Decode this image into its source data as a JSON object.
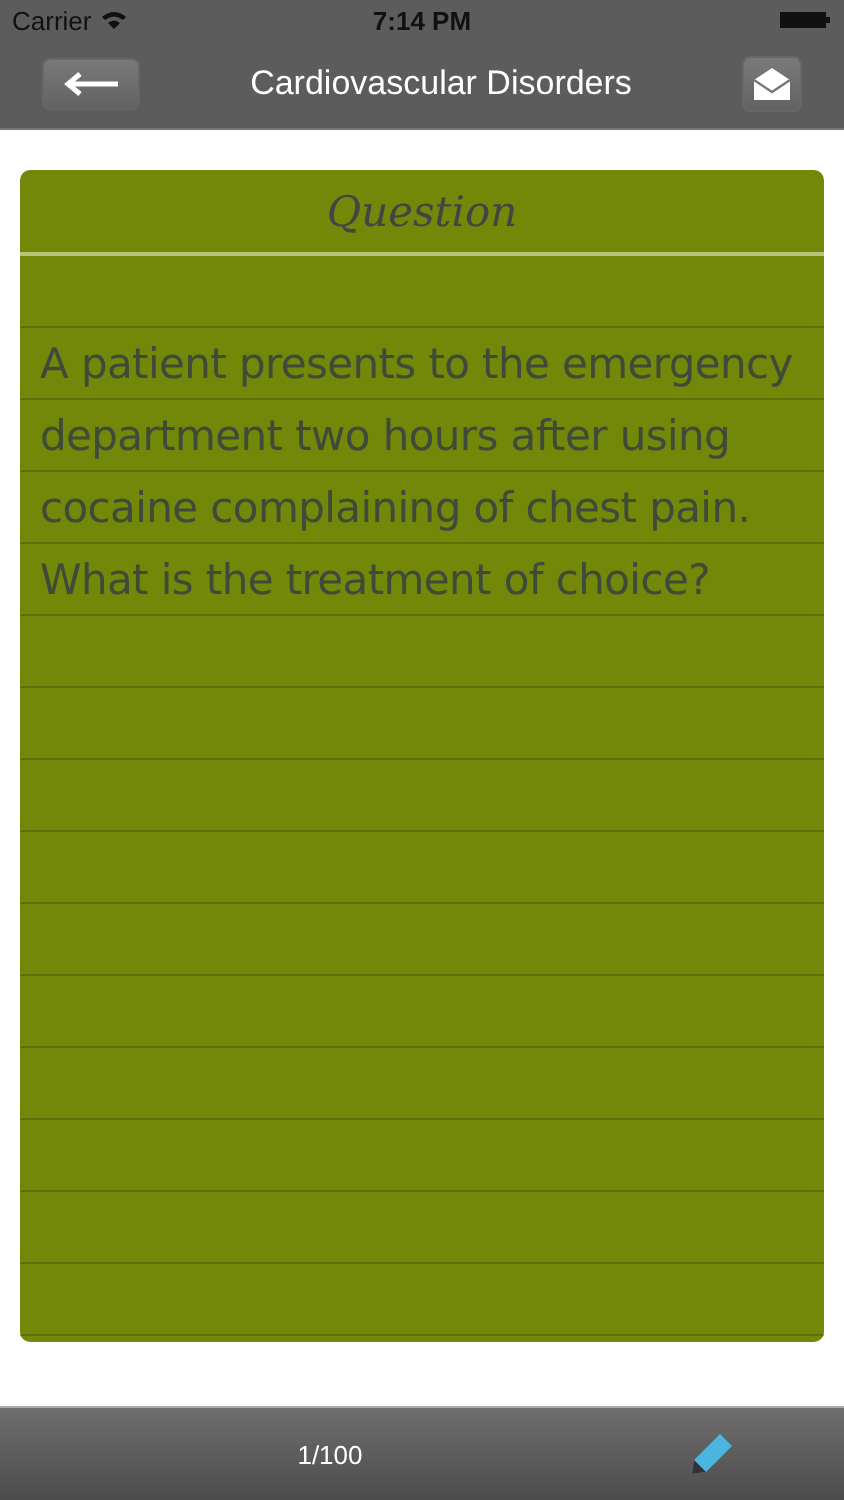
{
  "status_bar": {
    "carrier": "Carrier",
    "time": "7:14 PM"
  },
  "nav_bar": {
    "title": "Cardiovascular Disorders"
  },
  "card": {
    "heading": "Question",
    "text": "A patient presents to the emergency department two hours after using cocaine complaining of chest pain. What is the treatment of choice?"
  },
  "toolbar": {
    "counter": "1/100"
  }
}
